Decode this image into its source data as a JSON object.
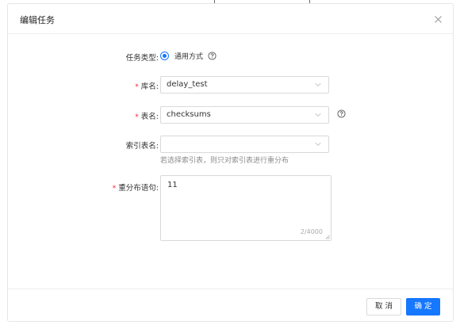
{
  "modal": {
    "title": "编辑任务"
  },
  "form": {
    "task_type": {
      "label": "任务类型:",
      "option": "通用方式"
    },
    "database": {
      "label": "库名:",
      "value": "delay_test"
    },
    "table": {
      "label": "表名:",
      "value": "checksums"
    },
    "index_table": {
      "label": "索引表名:",
      "value": "",
      "hint": "若选择索引表，则只对索引表进行重分布"
    },
    "redistribute_sql": {
      "label": "重分布语句:",
      "value": "11",
      "counter": "2/4000"
    }
  },
  "footer": {
    "cancel_label": "取 消",
    "ok_label": "确 定"
  },
  "colors": {
    "primary": "#1677ff",
    "required": "#f5222d"
  },
  "icons": [
    "close-icon",
    "help-icon",
    "chevron-down-icon"
  ]
}
